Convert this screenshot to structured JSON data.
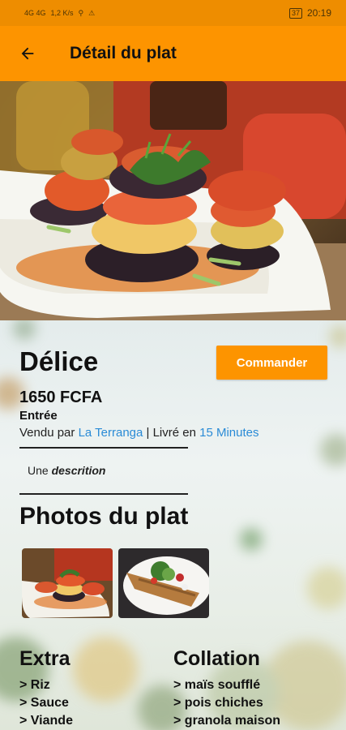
{
  "status_bar": {
    "signals": "4G 4G",
    "speed": "1,2 K/s",
    "battery": "37",
    "time": "20:19"
  },
  "app_bar": {
    "title": "Détail du plat"
  },
  "dish": {
    "name": "Délice",
    "order_label": "Commander",
    "price": "1650 FCFA",
    "category": "Entrée",
    "sold_by_prefix": "Vendu par ",
    "vendor": "La Terranga",
    "delivered_prefix": " | Livré en ",
    "delivery_time": "15 Minutes",
    "description_prefix": "Une ",
    "description_word": "descrition"
  },
  "photos": {
    "title": "Photos du plat"
  },
  "extra": {
    "title": "Extra",
    "items": [
      "> Riz",
      "> Sauce",
      "> Viande"
    ]
  },
  "collation": {
    "title": "Collation",
    "items": [
      "> maïs soufflé",
      "> pois chiches",
      "> granola maison"
    ]
  },
  "colors": {
    "accent": "#fd9400",
    "link": "#2a8bd6"
  }
}
